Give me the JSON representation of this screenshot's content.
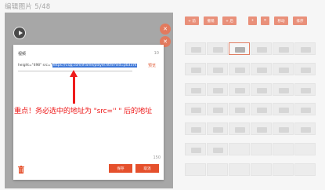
{
  "header": {
    "title": "编辑图片 5/48"
  },
  "preview": {
    "side_1_icon": "close-icon",
    "side_2_icon": "close-icon"
  },
  "dialog": {
    "title": "视频",
    "count_top": "10",
    "code_prefix": "height=\"498\" src=\"",
    "code_selected": "https://v.qq.com/iframe/player.html?vid=p0337k",
    "preview_link": "预览",
    "note": "重点！务必选中的地址为 \"src='' \" 后的地址",
    "count_bottom": "150",
    "save_label": "保存",
    "cancel_label": "取消"
  },
  "toolbar": {
    "btn1": "+ 前",
    "btn2": "撤销",
    "btn3": "+ 后",
    "btn4": "+",
    "btn5": "✕",
    "btn6": "移动",
    "btn7": "排序"
  },
  "grid": {
    "plus": "+ 后"
  },
  "colors": {
    "accent": "#e5502c",
    "arrow": "#ee1c1c",
    "selection": "#3f78d8"
  }
}
